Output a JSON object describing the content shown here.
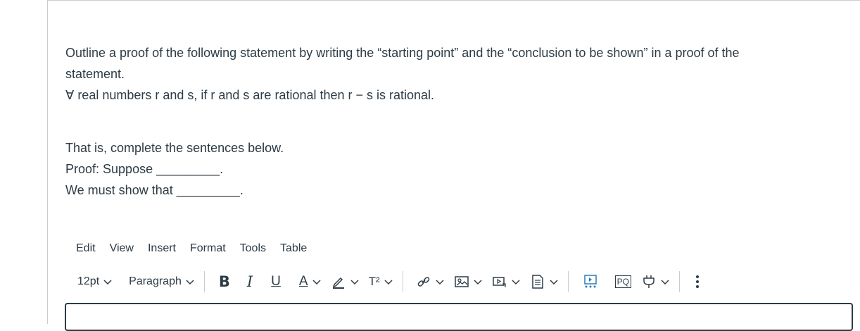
{
  "question": {
    "line1": "Outline a proof of the following statement by writing the “starting point” and the “conclusion to be shown” in a proof of the",
    "line2": "statement.",
    "statement": "∀ real numbers r and s, if r and s are rational then r − s is rational.",
    "instruction": "That is, complete the sentences below.",
    "proof_line": "Proof: Suppose _________.",
    "show_line": "We must show that _________."
  },
  "menubar": {
    "items": [
      "Edit",
      "View",
      "Insert",
      "Format",
      "Tools",
      "Table"
    ]
  },
  "toolbar": {
    "font_size": "12pt",
    "block_format": "Paragraph",
    "bold": "B",
    "italic": "I",
    "underline": "U",
    "text_color": "A",
    "superscript": "T²",
    "pq_label": "PQ",
    "icons": [
      "chevron-down-icon",
      "highlight-pen-icon",
      "link-icon",
      "image-icon",
      "media-icon",
      "document-icon",
      "apps-icon",
      "plug-icon",
      "more-icon"
    ]
  }
}
